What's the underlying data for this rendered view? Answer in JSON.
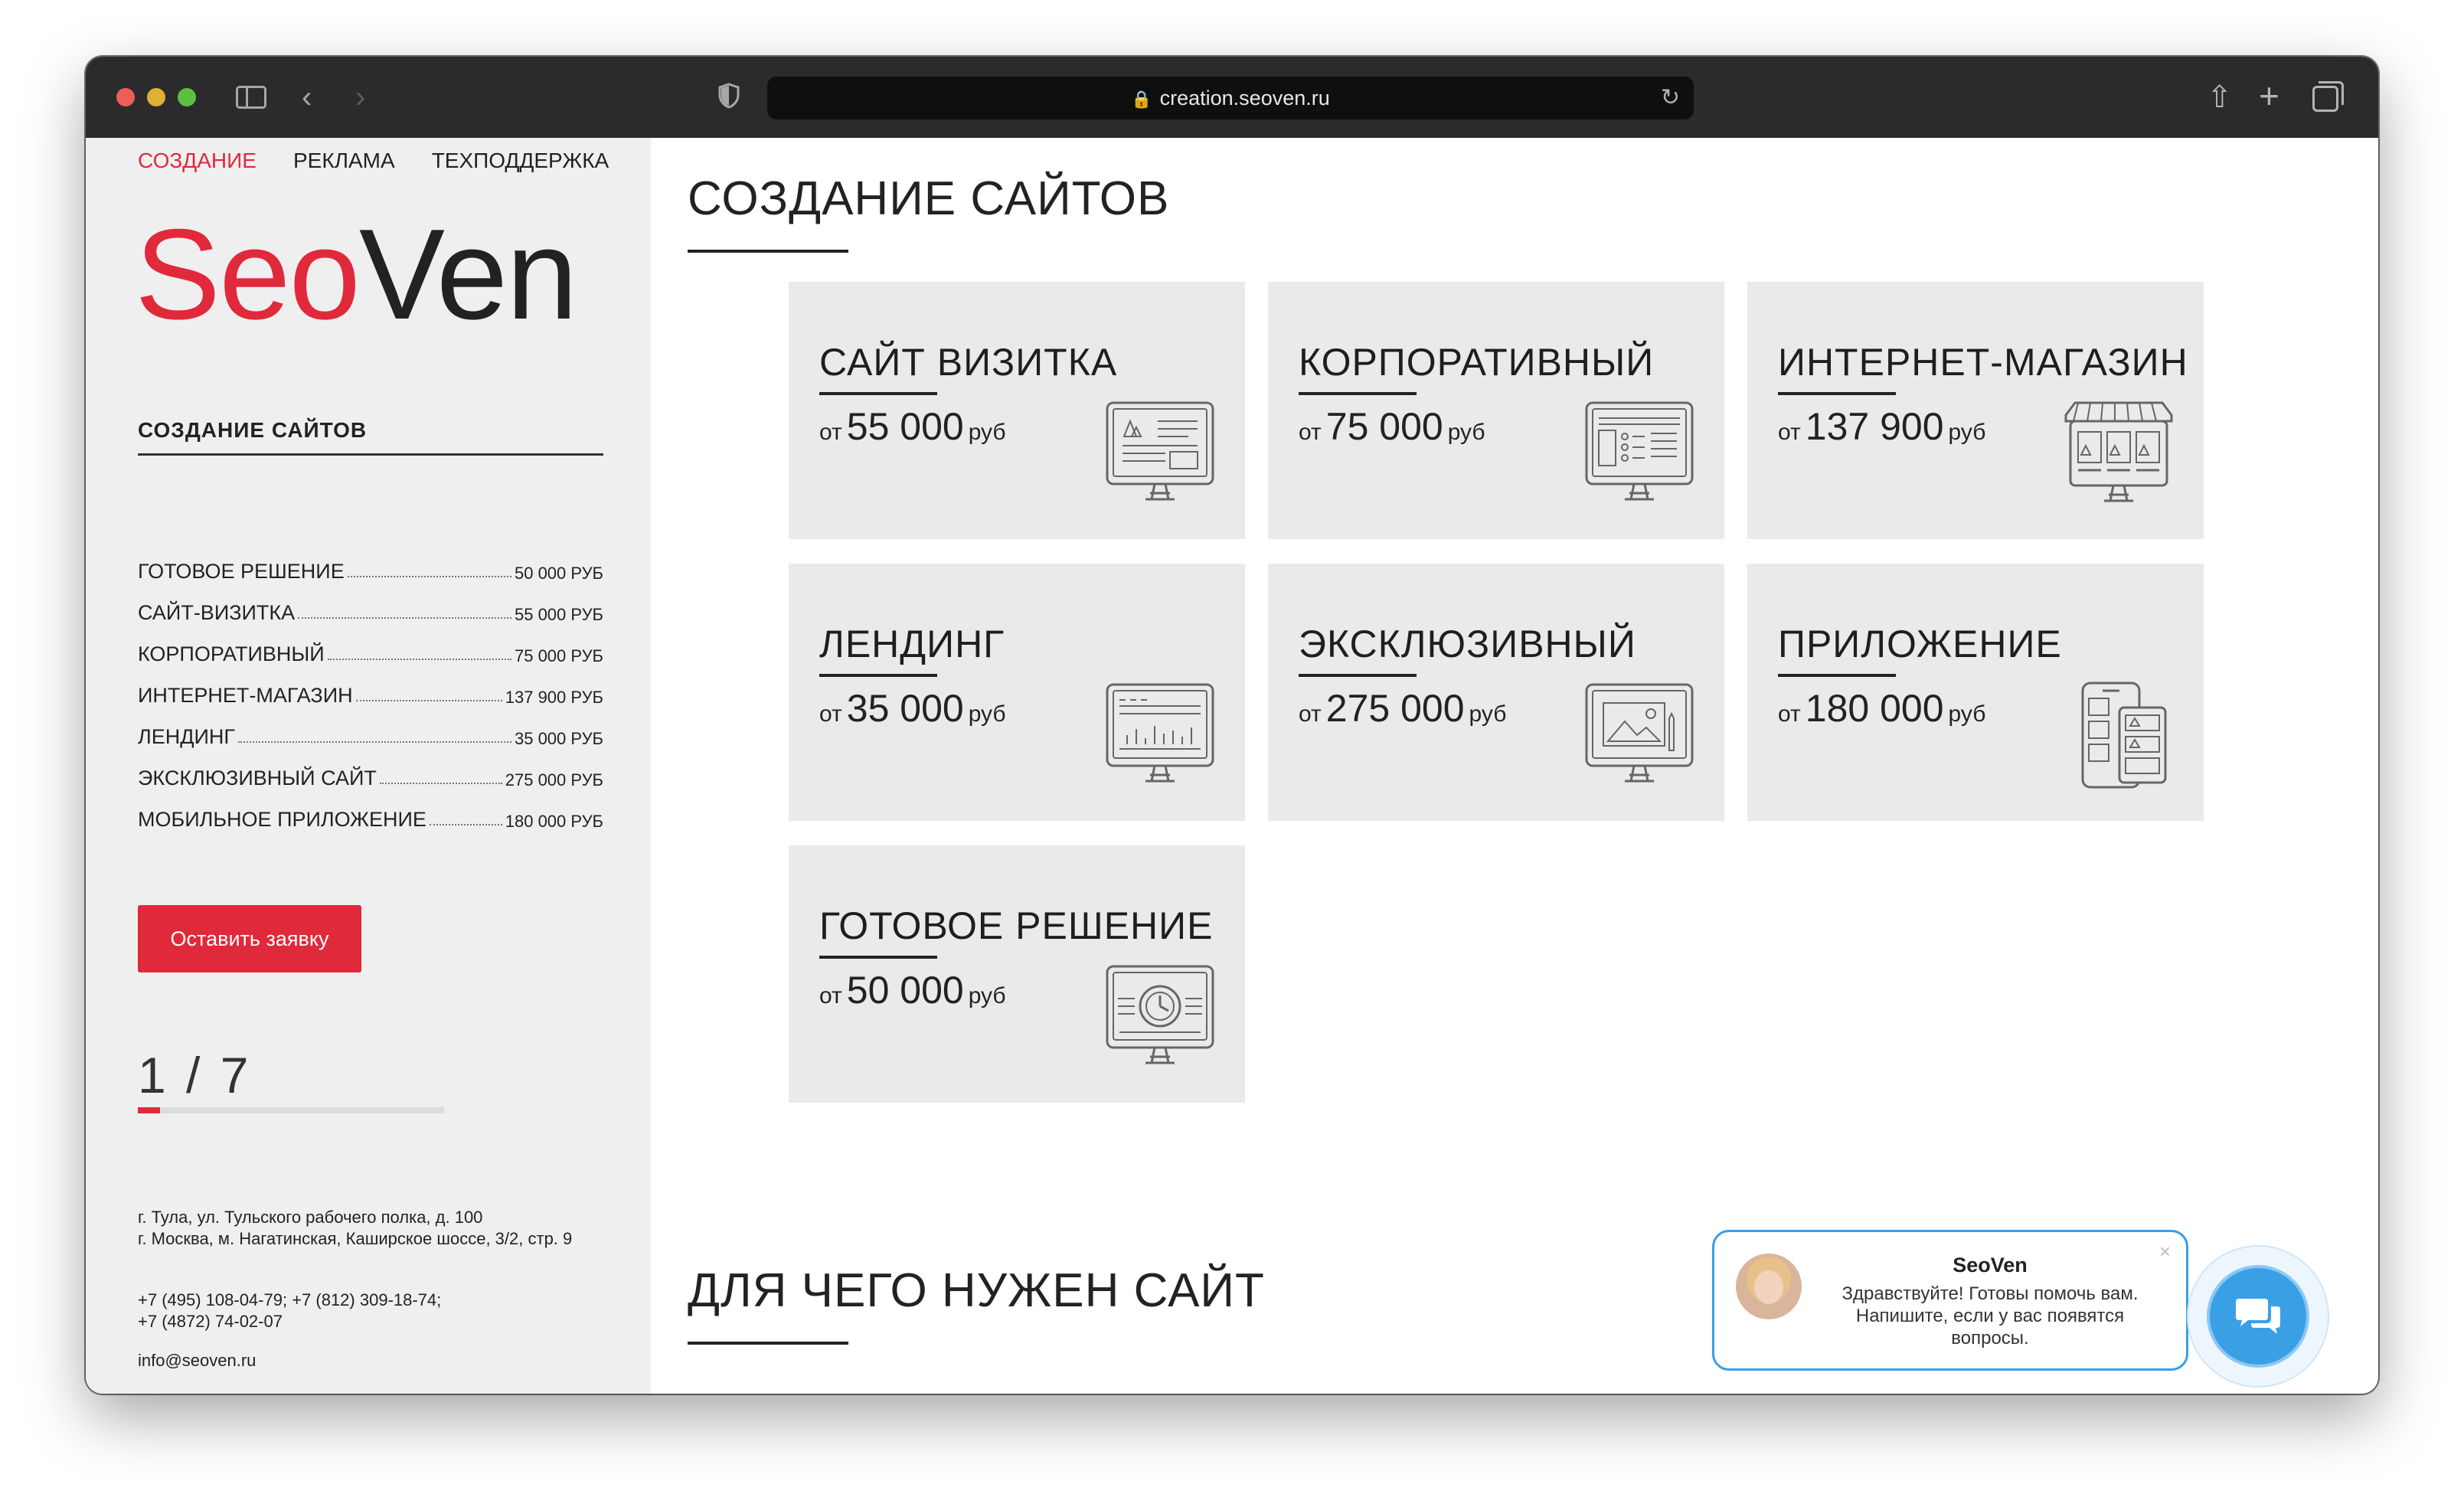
{
  "browser": {
    "url": "creation.seoven.ru"
  },
  "nav": {
    "items": [
      "СОЗДАНИЕ",
      "РЕКЛАМА",
      "ТЕХПОДДЕРЖКА"
    ]
  },
  "logo": {
    "part1": "Seo",
    "part2": "Ven"
  },
  "sidebar": {
    "section_title": "СОЗДАНИЕ САЙТОВ",
    "prices": [
      {
        "name": "ГОТОВОЕ РЕШЕНИЕ",
        "value": "50 000 РУБ"
      },
      {
        "name": "САЙТ-ВИЗИТКА",
        "value": "55 000 РУБ"
      },
      {
        "name": "КОРПОРАТИВНЫЙ",
        "value": "75 000 РУБ"
      },
      {
        "name": "ИНТЕРНЕТ-МАГАЗИН",
        "value": "137 900 РУБ"
      },
      {
        "name": "ЛЕНДИНГ",
        "value": "35 000 РУБ"
      },
      {
        "name": "ЭКСКЛЮЗИВНЫЙ САЙТ",
        "value": "275 000 РУБ"
      },
      {
        "name": "МОБИЛЬНОЕ ПРИЛОЖЕНИЕ",
        "value": "180 000 РУБ"
      }
    ],
    "cta": "Оставить заявку",
    "counter": "1 / 7",
    "progress_fraction": 0.0714,
    "address_line1": "г. Тула, ул. Тульского рабочего полка, д. 100",
    "address_line2": "г. Москва, м. Нагатинская, Каширское шоссе, 3/2, стр. 9",
    "phones_line1": "+7 (495) 108-04-79; +7 (812) 309-18-74;",
    "phones_line2": "+7 (4872) 74-02-07",
    "email": "info@seoven.ru"
  },
  "main": {
    "title": "СОЗДАНИЕ САЙТОВ",
    "title2": "ДЛЯ ЧЕГО НУЖЕН САЙТ",
    "cards": [
      {
        "title": "САЙТ ВИЗИТКА",
        "prefix": "от",
        "price": "55 000",
        "currency": "руб",
        "icon": "monitor-card-icon"
      },
      {
        "title": "КОРПОРАТИВНЫЙ",
        "prefix": "от",
        "price": "75 000",
        "currency": "руб",
        "icon": "monitor-list-icon"
      },
      {
        "title": "ИНТЕРНЕТ-МАГАЗИН",
        "prefix": "от",
        "price": "137 900",
        "currency": "руб",
        "icon": "monitor-shop-icon"
      },
      {
        "title": "ЛЕНДИНГ",
        "prefix": "от",
        "price": "35 000",
        "currency": "руб",
        "icon": "monitor-landing-icon"
      },
      {
        "title": "ЭКСКЛЮЗИВНЫЙ",
        "prefix": "от",
        "price": "275 000",
        "currency": "руб",
        "icon": "monitor-design-icon"
      },
      {
        "title": "ПРИЛОЖЕНИЕ",
        "prefix": "от",
        "price": "180 000",
        "currency": "руб",
        "icon": "mobile-app-icon"
      },
      {
        "title": "ГОТОВОЕ РЕШЕНИЕ",
        "prefix": "от",
        "price": "50 000",
        "currency": "руб",
        "icon": "monitor-clock-icon"
      }
    ]
  },
  "chat": {
    "name": "SeoVen",
    "message": "Здравствуйте! Готовы помочь вам. Напишите, если у вас появятся вопросы.",
    "close": "×"
  },
  "colors": {
    "accent": "#e0293a",
    "chat_blue": "#3aa0e6",
    "card_bg": "#eaeaea",
    "sidebar_bg": "#efefef"
  }
}
